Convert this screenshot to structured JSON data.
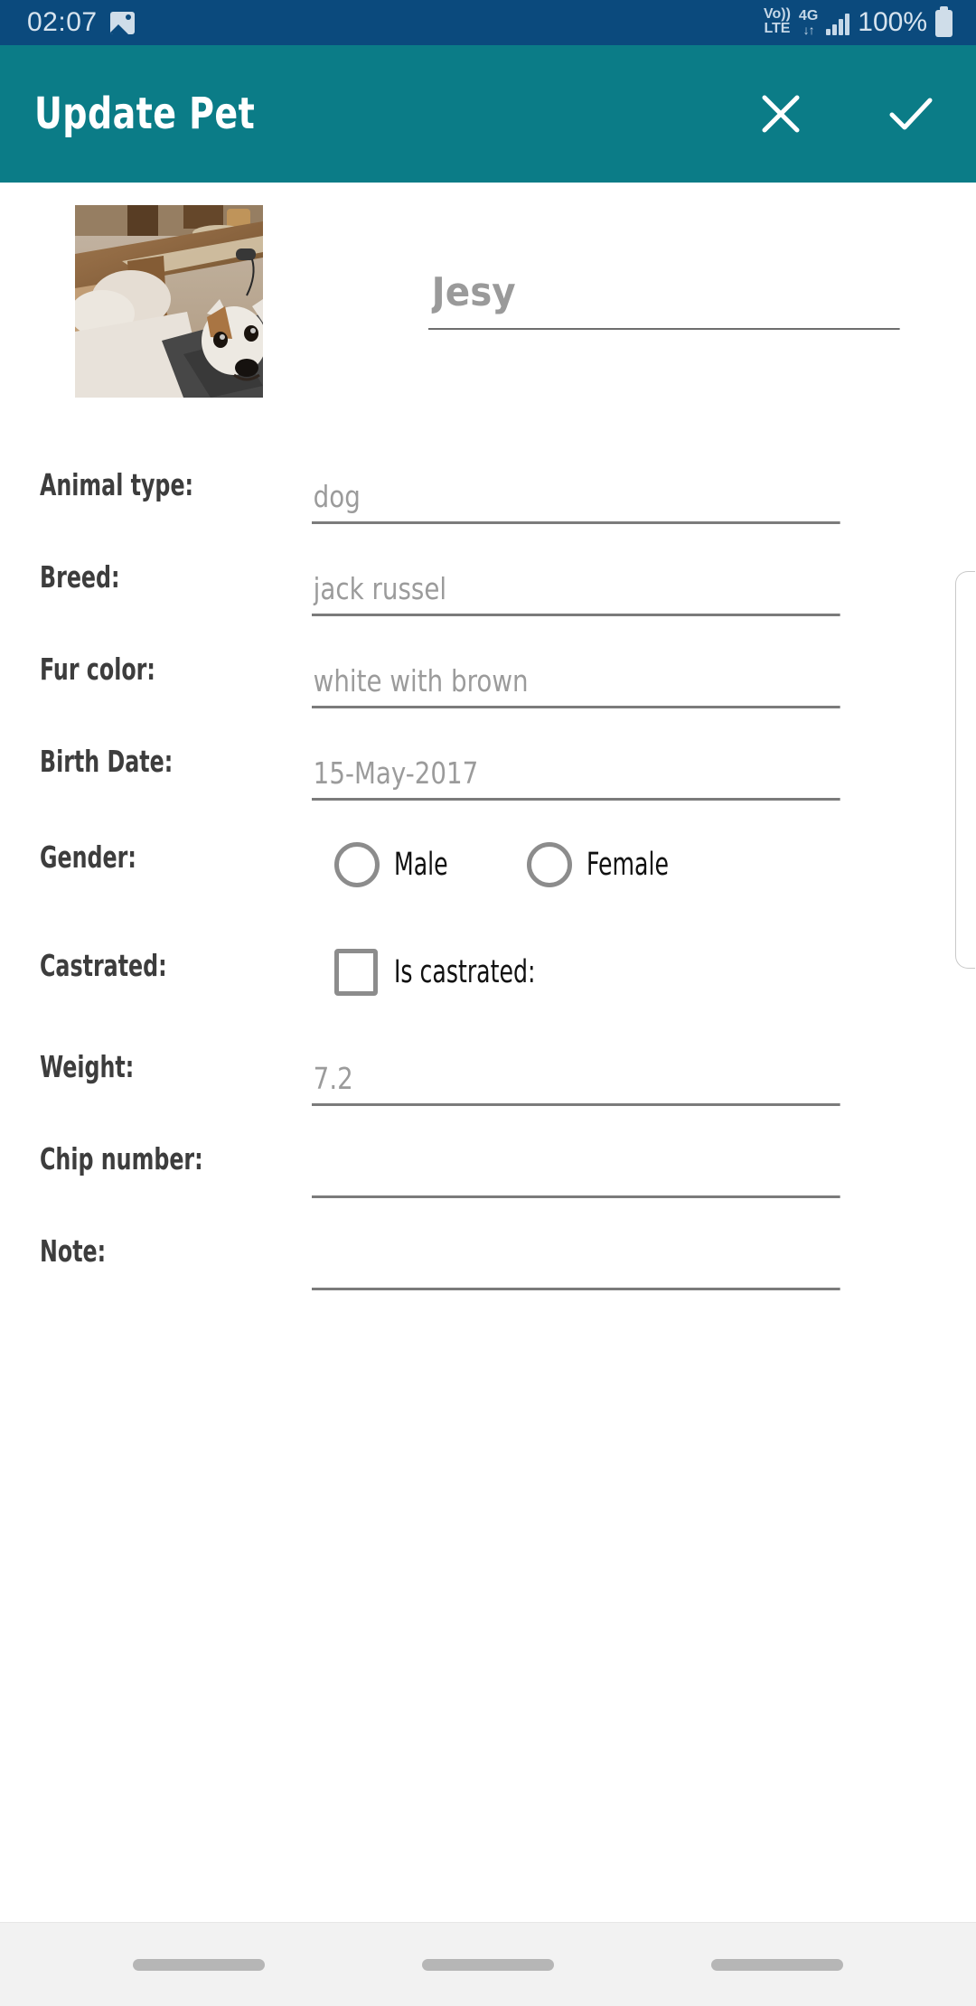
{
  "status_bar": {
    "time": "02:07",
    "photo_icon": "photo-icon",
    "volte_line1": "Vo))",
    "volte_line2": "LTE",
    "network_type": "4G",
    "network_arrows": "↓↑",
    "signal_icon": "signal-bars-icon",
    "battery_percent": "100%",
    "battery_icon": "battery-full-icon",
    "background_color": "#0b4a7d"
  },
  "app_bar": {
    "title": "Update Pet",
    "close_label": "close-icon",
    "confirm_label": "check-icon",
    "background_color": "#0b7c87",
    "text_color": "#ffffff"
  },
  "pet": {
    "photo_alt": "pet-photo",
    "name_value": "Jesy",
    "name_placeholder": "Name"
  },
  "form": {
    "rows": [
      {
        "label": "Animal type:",
        "value": "dog",
        "placeholder": "",
        "name": "animal-type"
      },
      {
        "label": "Breed:",
        "value": "jack russel",
        "placeholder": "",
        "name": "breed"
      },
      {
        "label": "Fur color:",
        "value": "white with brown",
        "placeholder": "",
        "name": "fur-color"
      },
      {
        "label": "Birth Date:",
        "value": "15-May-2017",
        "placeholder": "",
        "name": "birth-date"
      },
      {
        "label": "Gender:",
        "value": "",
        "placeholder": "",
        "name": "gender"
      },
      {
        "label": "Castrated:",
        "value": "",
        "placeholder": "",
        "name": "castrated"
      },
      {
        "label": "Weight:",
        "value": "7.2",
        "placeholder": "",
        "name": "weight"
      },
      {
        "label": "Chip number:",
        "value": "",
        "placeholder": "",
        "name": "chip-number"
      },
      {
        "label": "Note:",
        "value": "",
        "placeholder": "",
        "name": "note"
      }
    ],
    "gender": {
      "male_label": "Male",
      "female_label": "Female",
      "selected": ""
    },
    "castrated": {
      "checkbox_label": "Is castrated:",
      "checked": false
    }
  },
  "nav_bar": {
    "items": [
      "recents-pill",
      "home-pill",
      "back-pill"
    ]
  }
}
